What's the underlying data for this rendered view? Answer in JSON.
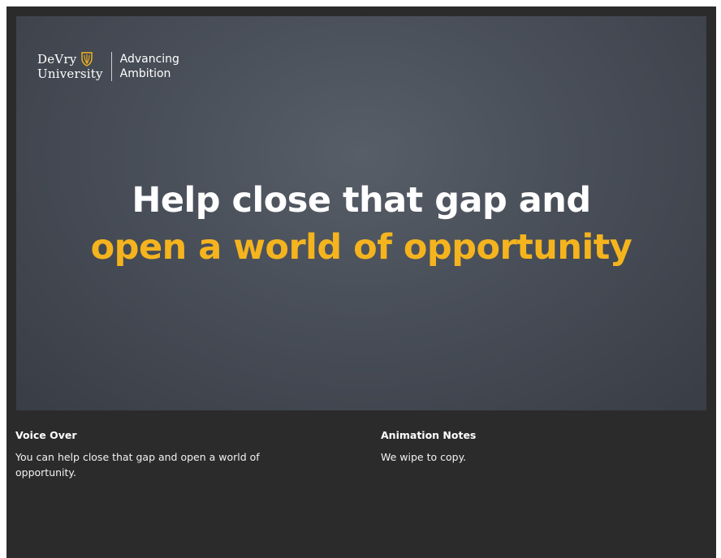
{
  "slide": {
    "logo": {
      "name_line1": "DeVry",
      "name_line2": "University",
      "shield": "shield-icon",
      "tagline_line1": "Advancing",
      "tagline_line2": "Ambition"
    },
    "headline_line1": "Help close that gap and",
    "headline_line2": "open a world of opportunity",
    "colors": {
      "background": "#4a505a",
      "accent": "#f5b41e",
      "text": "#ffffff"
    }
  },
  "voice_over": {
    "title": "Voice Over",
    "text": "You can help close that gap and open a world of opportunity."
  },
  "animation_notes": {
    "title": "Animation Notes",
    "text": "We wipe to copy."
  }
}
